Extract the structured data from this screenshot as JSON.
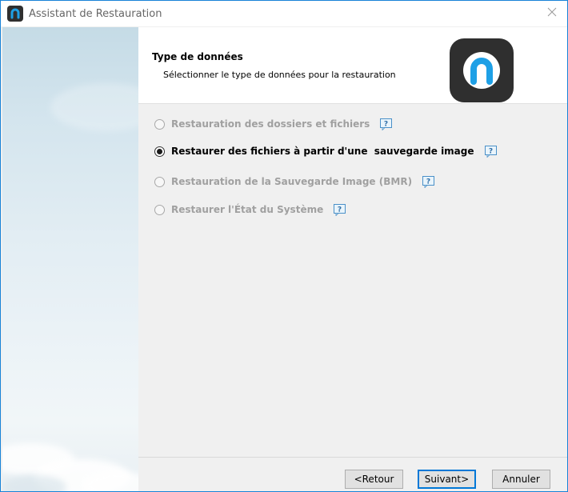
{
  "window": {
    "title": "Assistant de Restauration"
  },
  "header": {
    "title": "Type de données",
    "subtitle": "Sélectionner le type de données pour la restauration",
    "logo_icon": "brand-logo-icon"
  },
  "options": [
    {
      "label": "Restauration des dossiers et fichiers",
      "selected": false,
      "enabled": false
    },
    {
      "label": "Restaurer des fichiers à partir d'une  sauvegarde image",
      "selected": true,
      "enabled": true
    },
    {
      "label": "Restauration de la Sauvegarde Image (BMR)",
      "selected": false,
      "enabled": false
    },
    {
      "label": "Restaurer l'État du Système",
      "selected": false,
      "enabled": false
    }
  ],
  "buttons": {
    "back": "<Retour",
    "next": "Suivant>",
    "cancel": "Annuler"
  },
  "icons": {
    "close": "close-icon",
    "help": "help-icon",
    "app": "app-icon"
  },
  "colors": {
    "window_border": "#1883d7",
    "brand_dark": "#2f2f2f",
    "brand_blue": "#1ea0e6",
    "disabled_text": "#a0a0a0",
    "default_button_border": "#0078d7"
  }
}
